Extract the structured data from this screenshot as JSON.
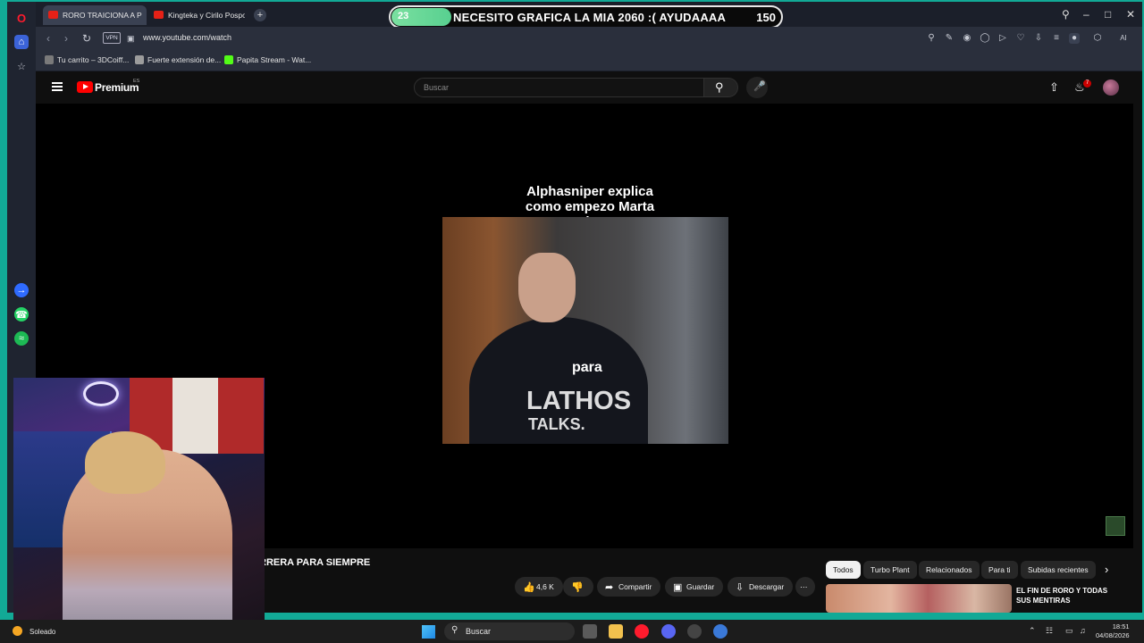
{
  "tabs": [
    {
      "label": "RORO TRAICIONA A P",
      "active": true
    },
    {
      "label": "Kingteka y Cirilo Pospo",
      "active": false
    }
  ],
  "stream_goal": {
    "current": "23",
    "text": "NECESITO GRAFICA LA MIA 2060 :( AYUDAAAA",
    "target": "150",
    "progress_fraction": 0.153
  },
  "address_bar": {
    "vpn_label": "VPN",
    "url": "www.youtube.com/watch",
    "ai_label": "AI"
  },
  "bookmarks": [
    {
      "label": "Tu carrito – 3DCoiff...",
      "icon_color": "#7a7a7a"
    },
    {
      "label": "Fuerte extensión de...",
      "icon_color": "#9c9c9c"
    },
    {
      "label": "Papita Stream - Wat...",
      "icon_color": "#53fc18"
    }
  ],
  "youtube": {
    "brand": "Premium",
    "region": "ES",
    "search_placeholder": "Buscar",
    "notification_count": "7"
  },
  "video": {
    "title_line1": "Alphasniper explica",
    "title_line2": "como empezo Marta Diaz",
    "subtitle": "para",
    "brand_line1": "LATHOS",
    "brand_line2": "TALKS."
  },
  "below_video": {
    "heading": "RRERA PARA SIEMPRE",
    "like_count": "4,6 K",
    "share": "Compartir",
    "save": "Guardar",
    "download": "Descargar"
  },
  "chips": [
    "Todos",
    "Turbo Plant",
    "Relacionados",
    "Para ti",
    "Subidas recientes"
  ],
  "recommendation": {
    "title": "EL FIN DE RORO Y TODAS SUS MENTIRAS"
  },
  "taskbar": {
    "weather": "Soleado",
    "search": "Buscar",
    "time": "18:51",
    "date": "04/08/2026"
  }
}
